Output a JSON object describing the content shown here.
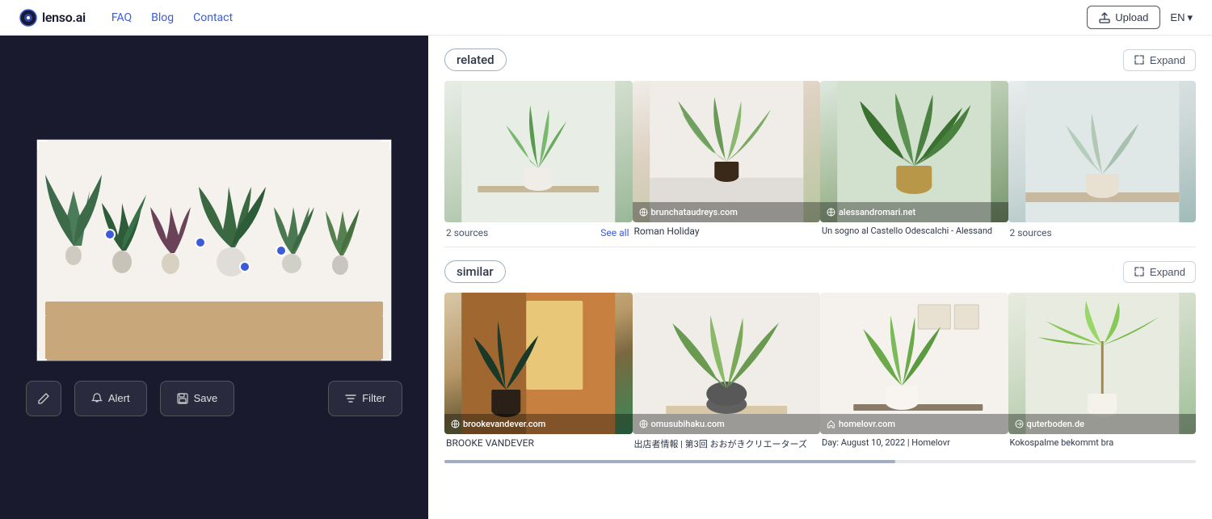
{
  "header": {
    "logo_text": "lenso.ai",
    "nav_items": [
      "FAQ",
      "Blog",
      "Contact"
    ],
    "upload_label": "Upload",
    "lang_label": "EN",
    "lang_arrow": "▾"
  },
  "left_panel": {
    "edit_icon": "✏",
    "buttons": [
      {
        "id": "alert",
        "icon": "🔔",
        "label": "Alert"
      },
      {
        "id": "save",
        "icon": "💾",
        "label": "Save"
      },
      {
        "id": "filter",
        "icon": "⊟",
        "label": "Filter"
      }
    ]
  },
  "sections": [
    {
      "id": "related",
      "tag_label": "related",
      "expand_label": "Expand",
      "items": [
        {
          "id": "r1",
          "source_count": "2  sources",
          "see_all": "See all",
          "caption": "",
          "overlay": null,
          "plant_class": "plant-1"
        },
        {
          "id": "r2",
          "overlay_icon": "globe",
          "overlay_text": "brunchataudreys.com",
          "caption": "Roman Holiday",
          "plant_class": "plant-2"
        },
        {
          "id": "r3",
          "overlay_icon": "globe",
          "overlay_text": "alessandromari.net",
          "caption": "Un sogno al Castello Odescalchi - Alessand",
          "plant_class": "plant-3"
        },
        {
          "id": "r4",
          "source_count": "2  sources",
          "caption": "",
          "plant_class": "plant-4"
        }
      ]
    },
    {
      "id": "similar",
      "tag_label": "similar",
      "expand_label": "Expand",
      "items": [
        {
          "id": "s1",
          "overlay_icon": "globe",
          "overlay_text": "brookevandever.com",
          "caption": "BROOKE VANDEVER",
          "plant_class": "plant-5"
        },
        {
          "id": "s2",
          "overlay_icon": "globe",
          "overlay_text": "omusubihaku.com",
          "caption": "出店者情報 | 第3回 おおがきクリエーターズ",
          "plant_class": "plant-6"
        },
        {
          "id": "s3",
          "overlay_icon": "home",
          "overlay_text": "homelovr.com",
          "caption": "Day: August 10, 2022 | Homelovr",
          "plant_class": "plant-7"
        },
        {
          "id": "s4",
          "overlay_icon": "arrow",
          "overlay_text": "quterboden.de",
          "caption": "Kokospalme bekommt bra",
          "plant_class": "plant-8"
        }
      ]
    }
  ]
}
